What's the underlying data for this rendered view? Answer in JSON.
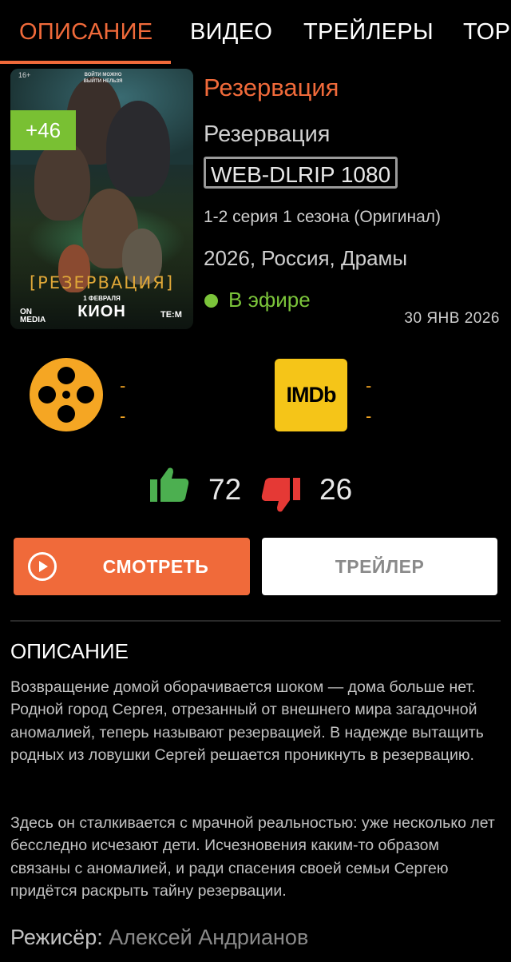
{
  "tabs": [
    {
      "label": "ОПИСАНИЕ",
      "active": true
    },
    {
      "label": "ВИДЕО",
      "active": false
    },
    {
      "label": "ТРЕЙЛЕРЫ",
      "active": false
    },
    {
      "label": "ТОР",
      "active": false
    }
  ],
  "poster": {
    "badge": "+46",
    "age_rating": "16+",
    "tagline": "ВОЙТИ МОЖНО ВЫЙТИ НЕЛЬЗЯ",
    "title": "[РЕЗЕРВАЦИЯ]",
    "release": "1 ФЕВРАЛЯ",
    "brand": "КИОН",
    "left_logo": "ON MEDIA",
    "right_logo": "TE:M"
  },
  "info": {
    "title": "Резервация",
    "original_title": "Резервация",
    "quality": "WEB-DLRIP 1080",
    "episodes": "1-2 серия 1 сезона (Оригинал)",
    "meta": "2026, Россия, Драмы",
    "status": "В эфире",
    "date": "30 ЯНВ 2026"
  },
  "ratings": {
    "kinopoisk": {
      "icon": "film-reel-icon",
      "value1": "-",
      "value2": "-"
    },
    "imdb": {
      "label": "IMDb",
      "value1": "-",
      "value2": "-"
    }
  },
  "votes": {
    "likes": "72",
    "dislikes": "26"
  },
  "buttons": {
    "watch": "СМОТРЕТЬ",
    "trailer": "ТРЕЙЛЕР"
  },
  "description": {
    "heading": "ОПИСАНИЕ",
    "paragraph1": "Возвращение домой оборачивается шоком — дома больше нет. Родной город Сергея, отрезанный от внешнего мира загадочной аномалией, теперь называют резервацией. В надежде вытащить родных из ловушки Сергей решается проникнуть в резервацию.",
    "paragraph2": "Здесь он сталкивается с мрачной реальностью: уже несколько лет бесследно исчезают дети. Исчезновения каким-то образом связаны с аномалией, и ради спасения своей семьи Сергею придётся раскрыть тайну резервации."
  },
  "director": {
    "label": "Режисёр:",
    "name": "Алексей Андрианов"
  },
  "colors": {
    "accent": "#f06a3a",
    "status": "#7bc43a",
    "imdb": "#f5c518",
    "kinopoisk": "#f5a623",
    "like": "#4caf50",
    "dislike": "#e53935"
  }
}
